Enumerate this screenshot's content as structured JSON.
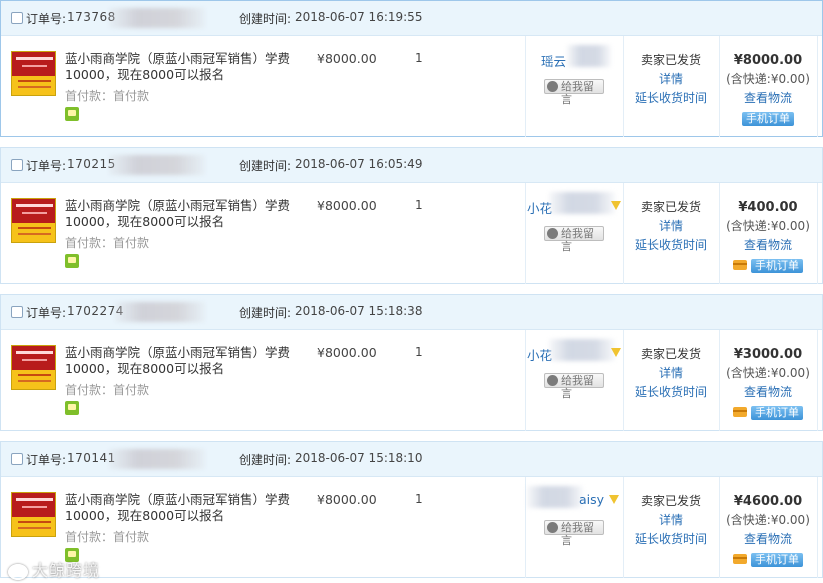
{
  "labels": {
    "order_no": "订单号:",
    "created": "创建时间:",
    "deposit": "首付款：首付款",
    "leave_message": "给我留言",
    "details": "详情",
    "extend_receipt": "延长收货时间",
    "view_logistics": "查看物流",
    "mobile_order": "手机订单"
  },
  "orders": [
    {
      "order_no": "173768",
      "created_time": "2018-06-07 16:19:55",
      "title": "蓝小雨商学院（原蓝小雨冠军销售）学费10000，现在8000可以报名",
      "price": "¥8000.00",
      "qty": "1",
      "buyer": "瑶云",
      "status": "卖家已发货",
      "total": "¥8000.00",
      "shipping": "(含快递:¥0.00)"
    },
    {
      "order_no": "170215",
      "created_time": "2018-06-07 16:05:49",
      "title": "蓝小雨商学院（原蓝小雨冠军销售）学费10000，现在8000可以报名",
      "price": "¥8000.00",
      "qty": "1",
      "buyer": "小花",
      "status": "卖家已发货",
      "total": "¥400.00",
      "shipping": "(含快递:¥0.00)"
    },
    {
      "order_no": "1702274",
      "created_time": "2018-06-07 15:18:38",
      "title": "蓝小雨商学院（原蓝小雨冠军销售）学费10000，现在8000可以报名",
      "price": "¥8000.00",
      "qty": "1",
      "buyer": "小花",
      "status": "卖家已发货",
      "total": "¥3000.00",
      "shipping": "(含快递:¥0.00)"
    },
    {
      "order_no": "170141",
      "created_time": "2018-06-07 15:18:10",
      "title": "蓝小雨商学院（原蓝小雨冠军销售）学费10000，现在8000可以报名",
      "price": "¥8000.00",
      "qty": "1",
      "buyer": "aisy",
      "status": "卖家已发货",
      "total": "¥4600.00",
      "shipping": "(含快递:¥0.00)"
    }
  ],
  "watermark": "大鲸跨境",
  "colors": {
    "header_bg": "#eaf5fc",
    "link": "#2a6fb5",
    "mobile_tag": "#3d93d8"
  }
}
